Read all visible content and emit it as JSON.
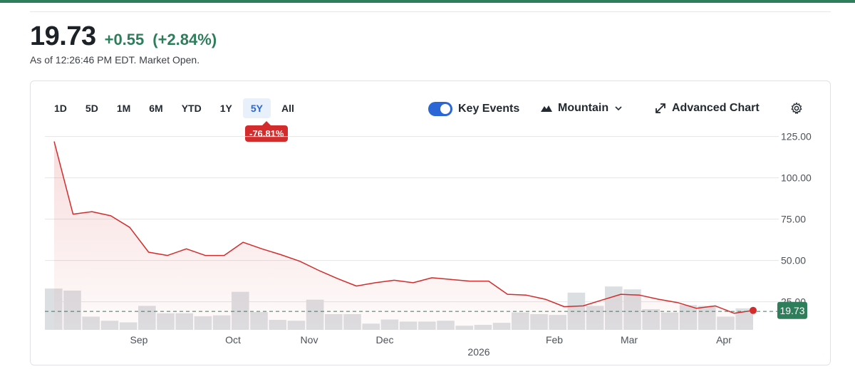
{
  "quote": {
    "price": "19.73",
    "change": "+0.55",
    "change_pct": "(+2.84%)",
    "as_of": "As of 12:26:46 PM EDT. Market Open.",
    "accent_color": "#2e7d5b"
  },
  "ranges": [
    "1D",
    "5D",
    "1M",
    "6M",
    "YTD",
    "1Y",
    "5Y",
    "All"
  ],
  "active_range": "5Y",
  "range_change": "-76.81%",
  "toolbar": {
    "key_events_label": "Key Events",
    "key_events_on": true,
    "chart_type_label": "Mountain",
    "chart_type_icon": "mountain-icon",
    "chevron_icon": "chevron-down-icon",
    "advanced_label": "Advanced Chart",
    "advanced_icon": "expand-icon",
    "settings_icon": "gear-icon"
  },
  "chart_data": {
    "type": "area",
    "x_ticks": [
      "Sep",
      "Oct",
      "Nov",
      "Dec",
      "Feb",
      "Mar",
      "Apr"
    ],
    "x_year_label": "2026",
    "y_ticks": [
      "125.00",
      "100.00",
      "75.00",
      "50.00",
      "25.00"
    ],
    "ylim": [
      8,
      130
    ],
    "grid": true,
    "last_price_label": "19.73",
    "previous_close": 19.18,
    "line_color": "#d22c2c",
    "series": [
      {
        "values": [
          122,
          78,
          79.5,
          77,
          70,
          55,
          53,
          57,
          53,
          53,
          61,
          57,
          53.5,
          49.5,
          44,
          39,
          34.5,
          36.5,
          38,
          36.5,
          39.5,
          38.5,
          37.5,
          37.5,
          29.5,
          29,
          26.5,
          22,
          22.5,
          26,
          29.5,
          29,
          26.5,
          24.5,
          21,
          22.5,
          18,
          19.73
        ]
      }
    ],
    "volume_relative": [
      1.0,
      0.95,
      0.32,
      0.22,
      0.18,
      0.58,
      0.4,
      0.4,
      0.33,
      0.35,
      0.92,
      0.43,
      0.24,
      0.22,
      0.73,
      0.38,
      0.38,
      0.15,
      0.25,
      0.2,
      0.2,
      0.22,
      0.1,
      0.12,
      0.17,
      0.42,
      0.38,
      0.36,
      0.9,
      0.58,
      1.05,
      0.98,
      0.5,
      0.42,
      0.6,
      0.58,
      0.32,
      0.52
    ]
  }
}
